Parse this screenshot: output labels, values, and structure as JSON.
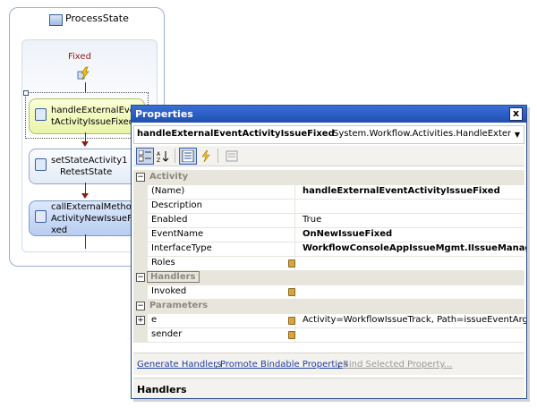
{
  "designer": {
    "state_title": "ProcessState",
    "event_label": "Fixed",
    "activities": [
      {
        "line1": "handleExternalEven",
        "line2": "tActivityIssueFixed"
      },
      {
        "line1": "setStateActivity1",
        "line2": "RetestState"
      },
      {
        "line1": "callExternalMethod",
        "line2": "ActivityNewIssueFi",
        "line3": "xed"
      }
    ]
  },
  "properties": {
    "title": "Properties",
    "close_glyph": "x",
    "selector_name": "handleExternalEventActivityIssueFixed",
    "selector_type": "System.Workflow.Activities.HandleExterna",
    "categories": {
      "activity": "Activity",
      "handlers": "Handlers",
      "parameters": "Parameters"
    },
    "rows": {
      "name": {
        "label": "(Name)",
        "value": "handleExternalEventActivityIssueFixed"
      },
      "description": {
        "label": "Description",
        "value": ""
      },
      "enabled": {
        "label": "Enabled",
        "value": "True"
      },
      "event_name": {
        "label": "EventName",
        "value": "OnNewIssueFixed"
      },
      "interface_type": {
        "label": "InterfaceType",
        "value": "WorkflowConsoleAppIssueMgmt.IIssueManag"
      },
      "roles": {
        "label": "Roles",
        "value": ""
      },
      "invoked": {
        "label": "Invoked",
        "value": ""
      },
      "e": {
        "label": "e",
        "value": "Activity=WorkflowIssueTrack, Path=issueEventArgs"
      },
      "sender": {
        "label": "sender",
        "value": ""
      }
    },
    "expander_glyph": "+",
    "collapse_glyph": "−",
    "commands": {
      "generate_handlers": "Generate Handlers",
      "promote_bindable": "Promote Bindable Properties",
      "bind_selected": "Bind Selected Property...",
      "separator": ","
    },
    "description_title": "Handlers"
  },
  "colors": {
    "titlebar": "#1f4fb0",
    "event_label": "#8b1c1c",
    "link": "#1f3ea0"
  }
}
